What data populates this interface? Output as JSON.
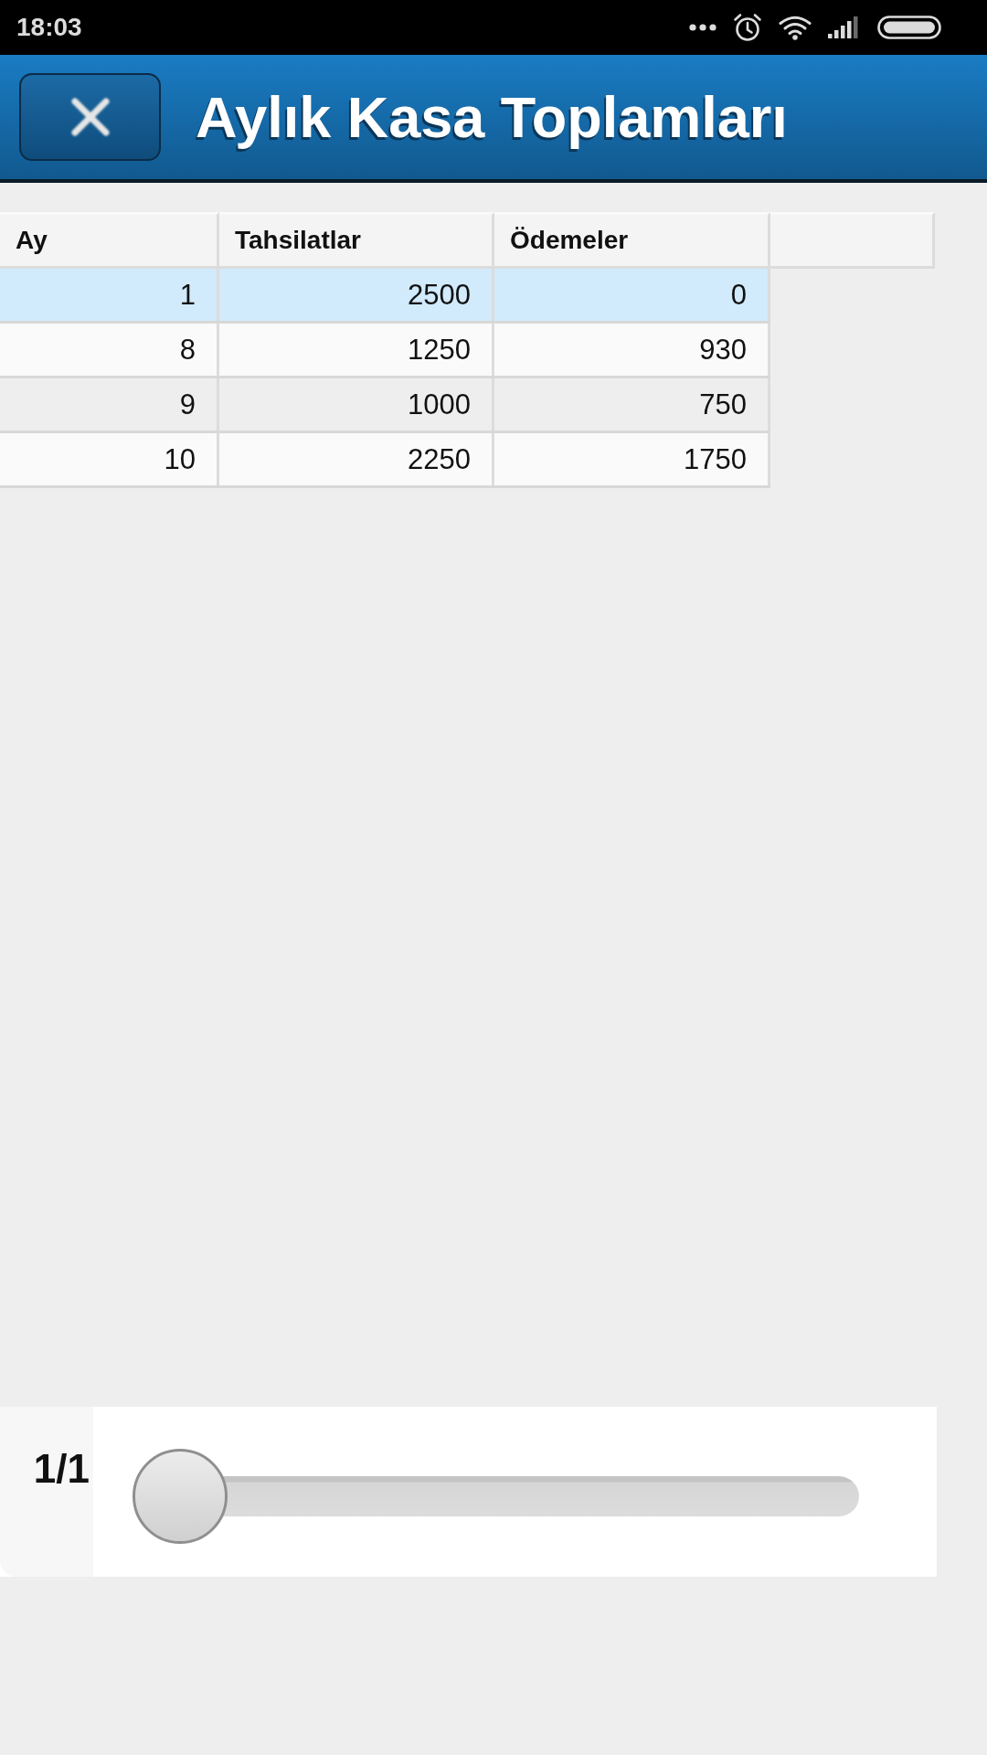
{
  "status_bar": {
    "time": "18:03"
  },
  "header": {
    "title": "Aylık Kasa Toplamları"
  },
  "table": {
    "columns": [
      "Ay",
      "Tahsilatlar",
      "Ödemeler"
    ],
    "rows": [
      {
        "cells": [
          "1",
          "2500",
          "0"
        ],
        "selected": true
      },
      {
        "cells": [
          "8",
          "1250",
          "930"
        ],
        "selected": false
      },
      {
        "cells": [
          "9",
          "1000",
          "750"
        ],
        "selected": false
      },
      {
        "cells": [
          "10",
          "2250",
          "1750"
        ],
        "selected": false
      }
    ]
  },
  "pager": {
    "label": "1/1",
    "level": 0
  }
}
